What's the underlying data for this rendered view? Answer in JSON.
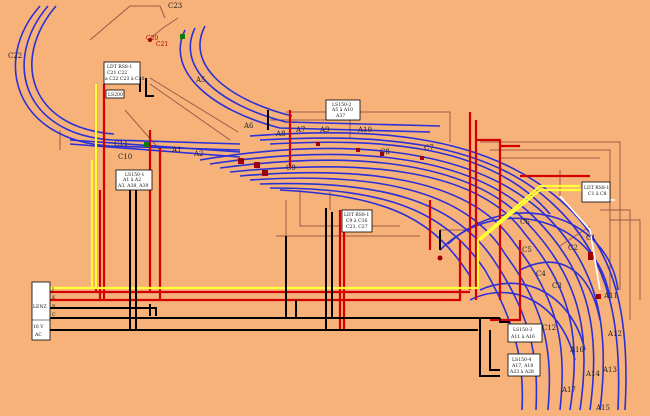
{
  "colors": {
    "background": "#f7b27a",
    "track": "#2b2fd6",
    "track_dark": "#0a0a8a",
    "wire_red": "#d40000",
    "wire_yellow": "#ffff33",
    "wire_black": "#000000",
    "wire_brown": "#9c5a4a",
    "wire_white": "#ffffff",
    "box_fill": "#ffffff"
  },
  "labels": {
    "c23": "C23",
    "c22": "C22",
    "c20": "C20",
    "c21": "C21",
    "a5": "A5",
    "a6": "A6",
    "a7": "A7",
    "a8": "A8",
    "a9": "A9",
    "a10": "A10",
    "c11": "C11",
    "c10": "C10",
    "a1": "A1",
    "a2": "A2",
    "c9": "C9",
    "c8": "C8",
    "c7": "C7",
    "c6": "C6",
    "c5": "C5",
    "c4": "C4",
    "c3": "C3",
    "c2": "C2",
    "c1": "C1",
    "a11": "A11",
    "a12": "A12",
    "a13": "A13",
    "a14": "A14",
    "a15": "A15",
    "a16": "A16",
    "a17": "A17",
    "c12": "C12"
  },
  "boxes": {
    "ldt_top": {
      "title": "LDT RS8-1",
      "line1": "C21      C22",
      "line2": "a C22   C23 à C20"
    },
    "ls200": {
      "title": "LS200"
    },
    "ls150_1": {
      "title": "LS150-1",
      "line1": "A1 à A2",
      "line2": "A3, A38, A39"
    },
    "ls150_2": {
      "title": "LS150-2",
      "line1": "A5 à A10",
      "line2": "A37"
    },
    "ldt_mid": {
      "title": "LDT RS8-1",
      "line1": "C9 à C16",
      "line2": "C23, C27"
    },
    "ldt_right": {
      "title": "LDT RS8-1",
      "line1": "C1 à C8"
    },
    "ls150_3": {
      "title": "LS150-3",
      "line1": "A11 à A16"
    },
    "ls150_4": {
      "title": "LS150-4",
      "line1": "A17, A18",
      "line2": "A23 à A28"
    },
    "lenz": {
      "title": "LENZ",
      "v16": "16 V",
      "ac": "AC",
      "j": "J",
      "k": "K",
      "b": "B",
      "c": "C"
    }
  }
}
